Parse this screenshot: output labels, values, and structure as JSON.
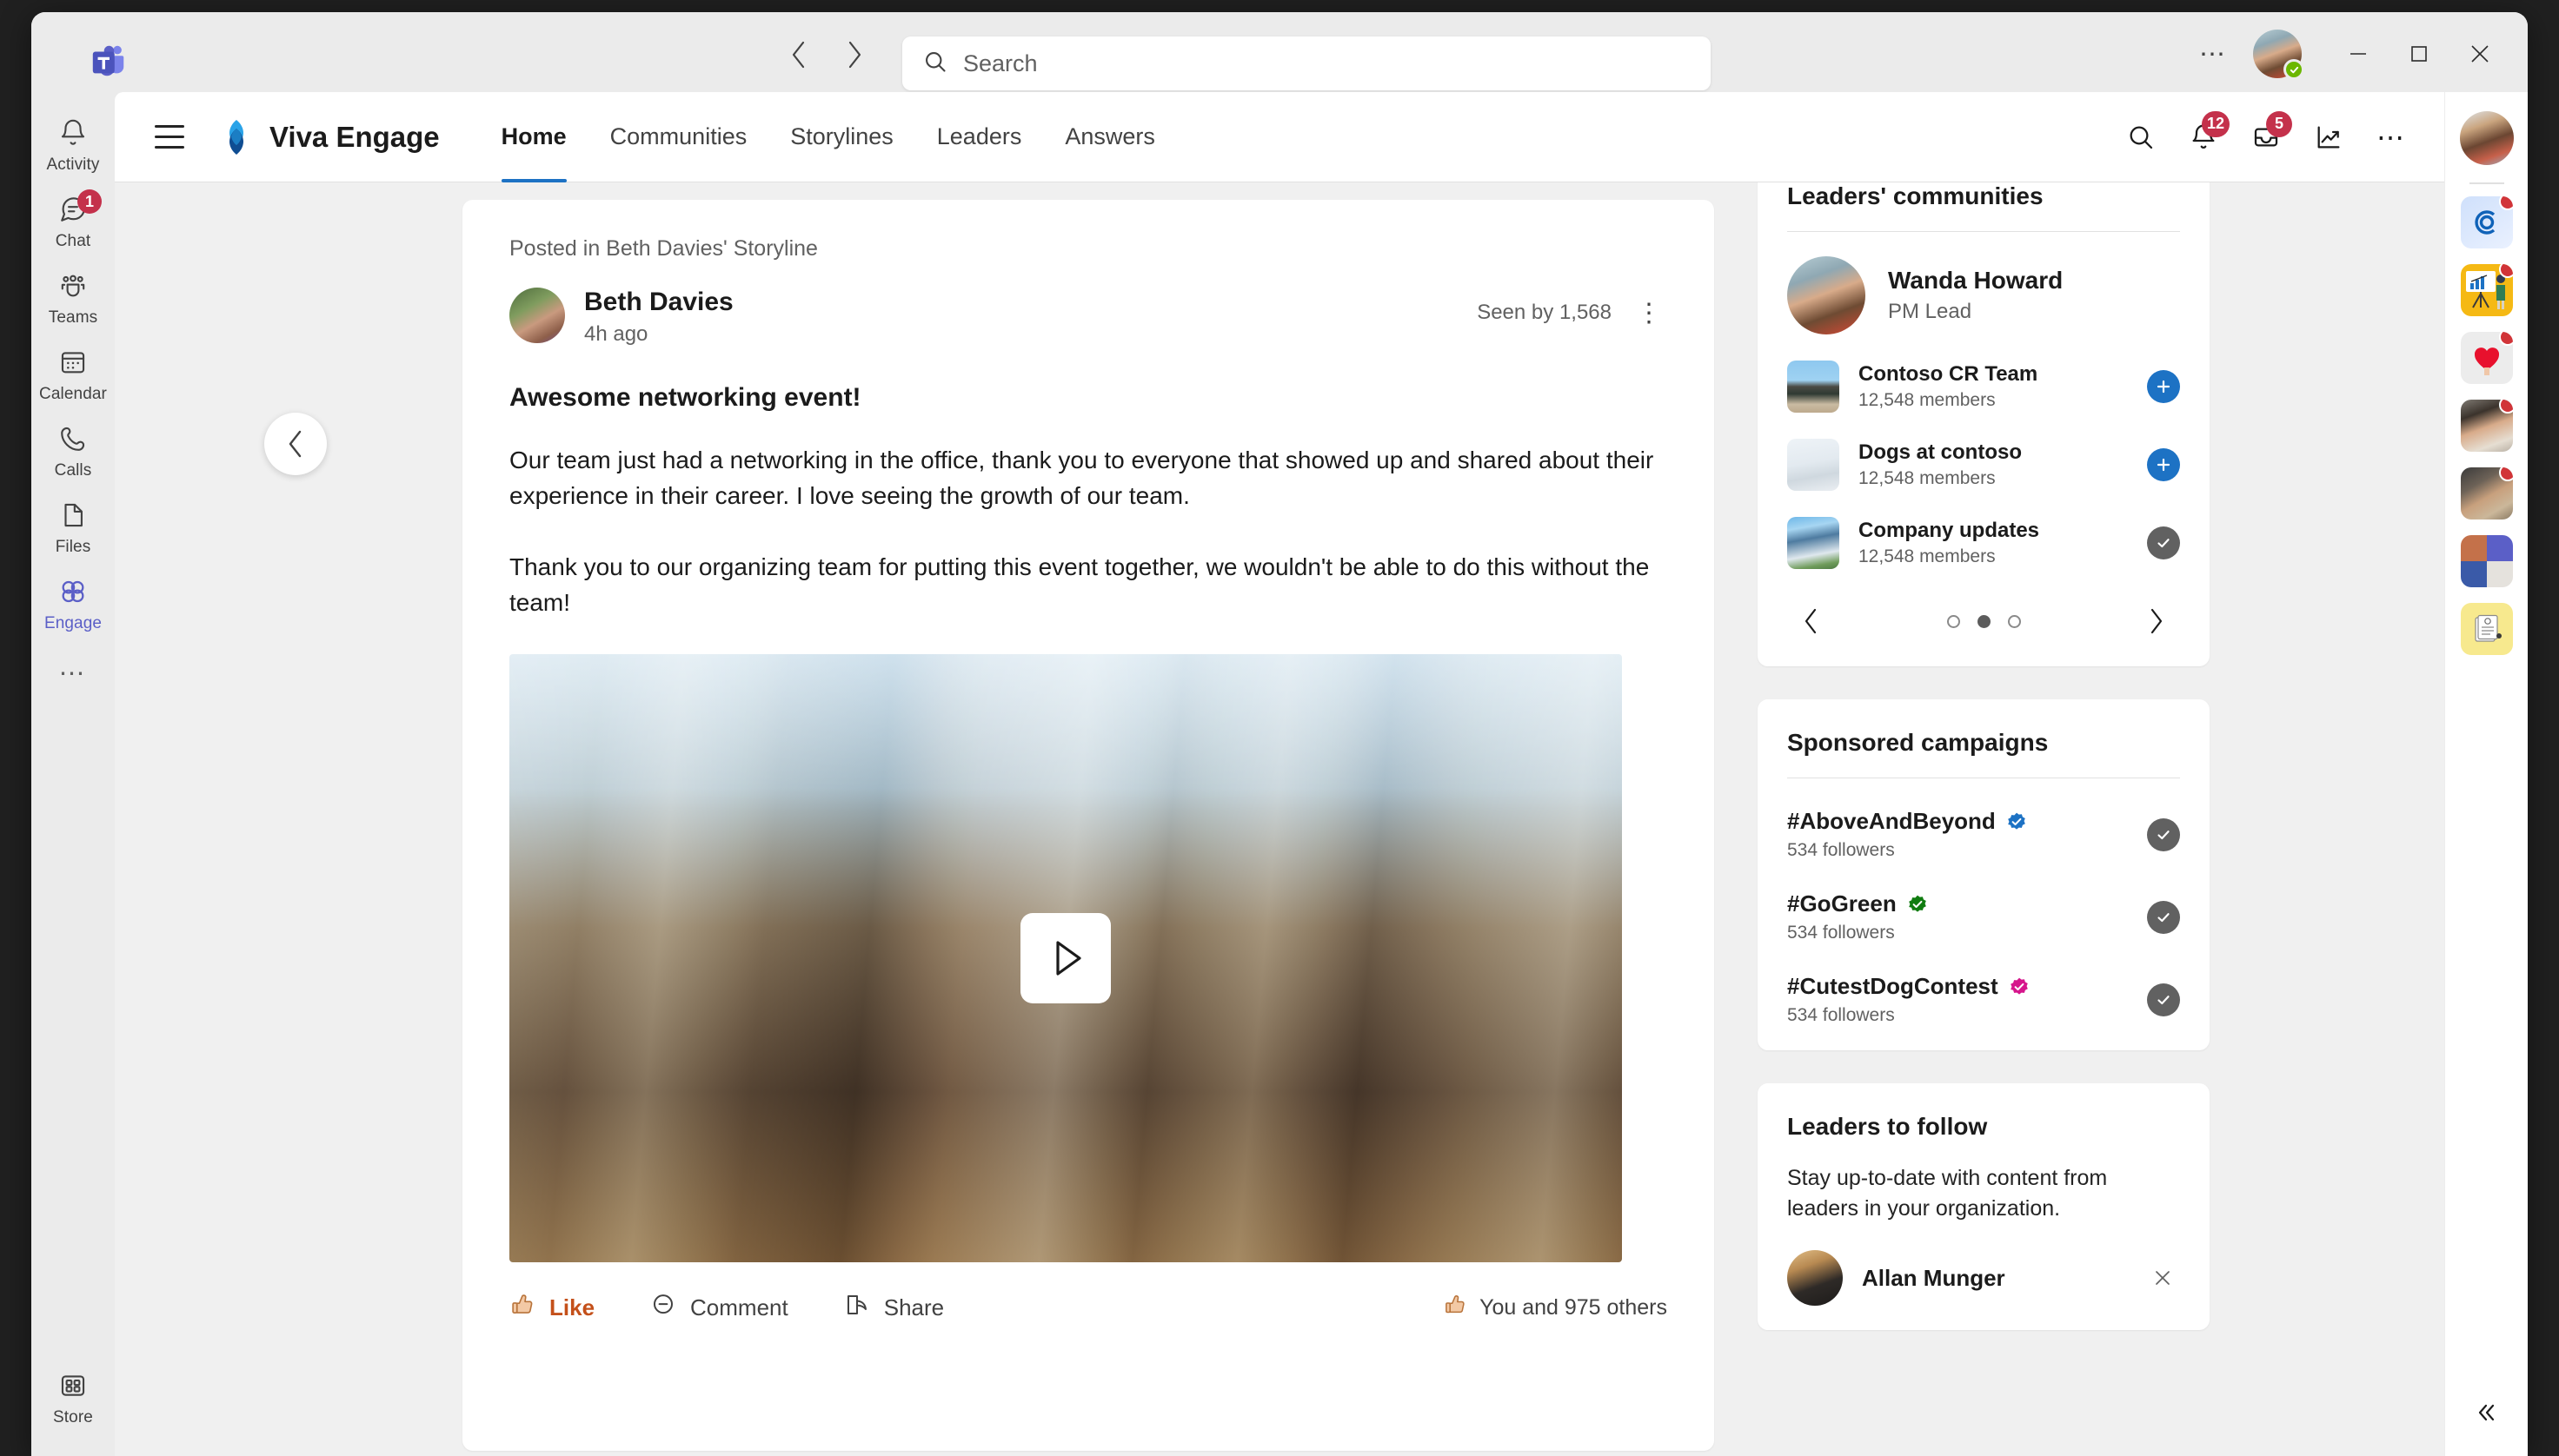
{
  "titlebar": {
    "back_label": "Back",
    "forward_label": "Forward",
    "search_placeholder": "Search",
    "more_label": "Settings and more",
    "minimize_label": "Minimize",
    "maximize_label": "Maximize",
    "close_label": "Close",
    "presence": "Available"
  },
  "left_rail": {
    "items": [
      {
        "label": "Activity",
        "icon": "bell-icon",
        "badge": "",
        "active": false
      },
      {
        "label": "Chat",
        "icon": "chat-icon",
        "badge": "1",
        "active": false
      },
      {
        "label": "Teams",
        "icon": "teams-icon",
        "badge": "",
        "active": false
      },
      {
        "label": "Calendar",
        "icon": "calendar-icon",
        "badge": "",
        "active": false
      },
      {
        "label": "Calls",
        "icon": "phone-icon",
        "badge": "",
        "active": false
      },
      {
        "label": "Files",
        "icon": "file-icon",
        "badge": "",
        "active": false
      },
      {
        "label": "Engage",
        "icon": "engage-icon",
        "badge": "",
        "active": true
      }
    ],
    "more_label": "More apps",
    "store_label": "Store"
  },
  "app_header": {
    "menu_label": "Navigation menu",
    "app_name": "Viva Engage",
    "tabs": [
      {
        "label": "Home",
        "active": true
      },
      {
        "label": "Communities",
        "active": false
      },
      {
        "label": "Storylines",
        "active": false
      },
      {
        "label": "Leaders",
        "active": false
      },
      {
        "label": "Answers",
        "active": false
      }
    ],
    "icons": [
      {
        "name": "search-icon",
        "badge": ""
      },
      {
        "name": "bell-icon",
        "badge": "12"
      },
      {
        "name": "inbox-icon",
        "badge": "5"
      },
      {
        "name": "analytics-icon",
        "badge": ""
      },
      {
        "name": "more-icon",
        "badge": ""
      }
    ]
  },
  "post": {
    "back_label": "Back",
    "posted_in": "Posted in Beth Davies' Storyline",
    "author": "Beth Davies",
    "timestamp": "4h ago",
    "seen_by": "Seen by 1,568",
    "more_label": "More options",
    "title": "Awesome networking event!",
    "paragraph1": "Our team just had a networking in the office, thank you to everyone that showed up and shared about their experience in their career. I love seeing the growth of our team.",
    "paragraph2": "Thank you to our organizing team for putting this event together, we wouldn't be able to do this without the team!",
    "play_label": "Play video",
    "actions": {
      "like": "Like",
      "comment": "Comment",
      "share": "Share",
      "reactions": "You and 975 others"
    }
  },
  "leaders_communities": {
    "title": "Leaders' communities",
    "leader": {
      "name": "Wanda Howard",
      "role": "PM Lead"
    },
    "communities": [
      {
        "name": "Contoso CR Team",
        "members": "12,548 members",
        "state": "join"
      },
      {
        "name": "Dogs at contoso",
        "members": "12,548 members",
        "state": "join"
      },
      {
        "name": "Company updates",
        "members": "12,548 members",
        "state": "joined"
      }
    ],
    "prev_label": "Previous",
    "next_label": "Next",
    "dots": 3,
    "active_dot": 1
  },
  "sponsored_campaigns": {
    "title": "Sponsored campaigns",
    "campaigns": [
      {
        "name": "#AboveAndBeyond",
        "followers": "534 followers",
        "badge_color": "#1d72c4",
        "state": "joined"
      },
      {
        "name": "#GoGreen",
        "followers": "534 followers",
        "badge_color": "#107c10",
        "state": "joined"
      },
      {
        "name": "#CutestDogContest",
        "followers": "534 followers",
        "badge_color": "#d6168c",
        "state": "joined"
      }
    ]
  },
  "leaders_to_follow": {
    "title": "Leaders to follow",
    "subtitle": "Stay up-to-date with content from leaders in your organization.",
    "person": "Allan Munger",
    "dismiss_label": "Dismiss"
  },
  "right_rail": {
    "avatar_label": "Your profile",
    "apps": [
      {
        "name": "company-app",
        "badge": true
      },
      {
        "name": "insights-app",
        "badge": true
      },
      {
        "name": "praise-app",
        "badge": true
      },
      {
        "name": "people-app",
        "badge": true
      },
      {
        "name": "learning-app",
        "badge": true
      },
      {
        "name": "meeting-app",
        "badge": false
      },
      {
        "name": "notes-app",
        "badge": false
      }
    ],
    "collapse_label": "Collapse panel"
  },
  "colors": {
    "accent": "#5b5fc7",
    "tab_underline": "#1d72c4",
    "badge_red": "#c4314b",
    "like_active": "#c4501a",
    "presence_green": "#6bb700"
  }
}
